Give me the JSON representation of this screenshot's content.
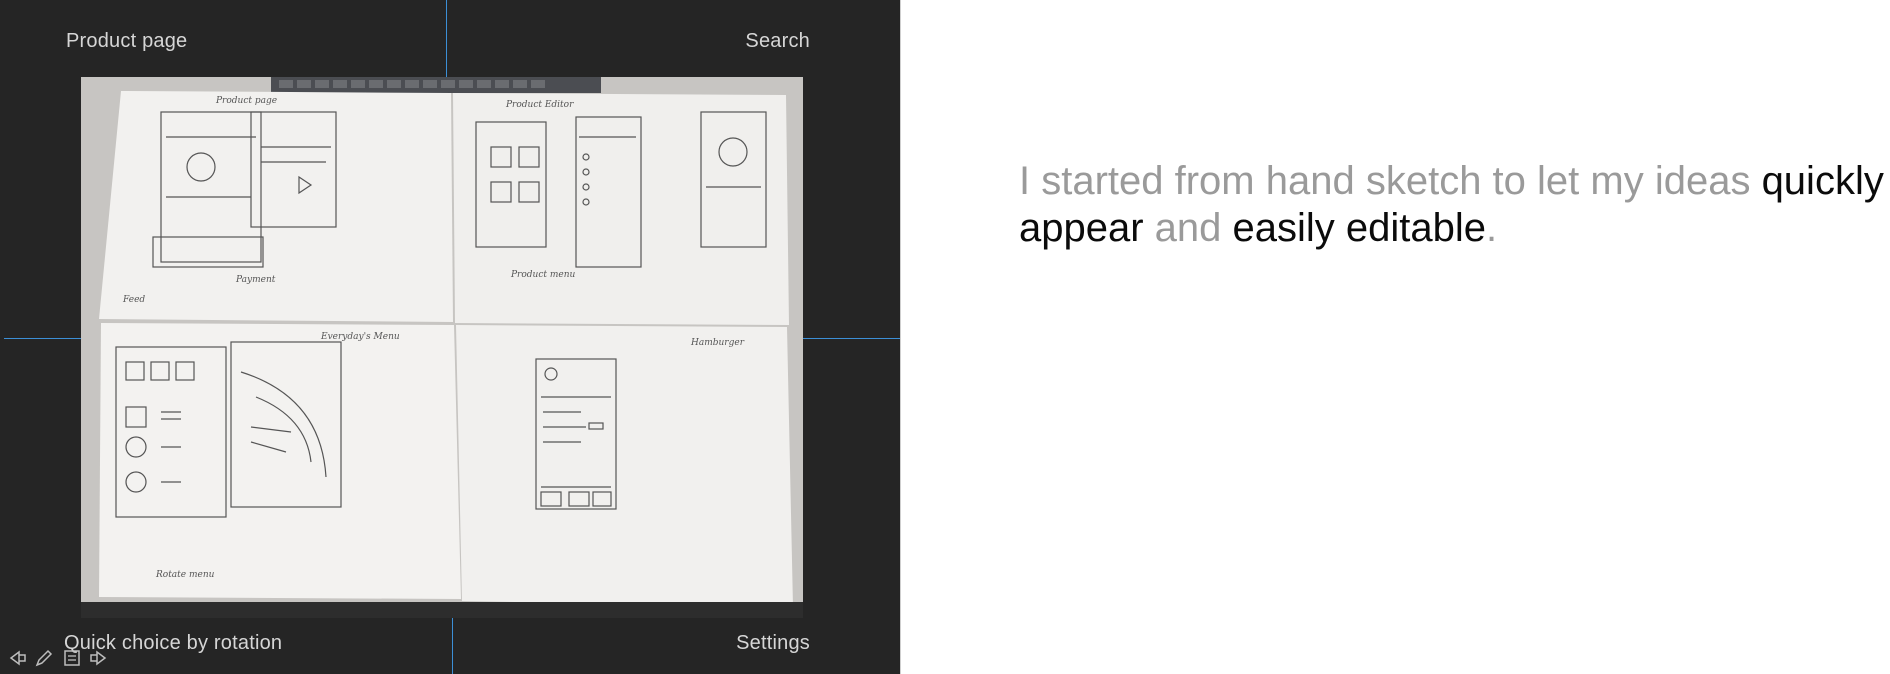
{
  "slide": {
    "label_top_left": "Product page",
    "label_top_right": "Search",
    "label_bottom_left": "Quick choice by rotation",
    "label_bottom_right": "Settings",
    "guide_color": "#3c8fd6",
    "background": "#252525"
  },
  "photo": {
    "description_icon": "hand-sketch-photo",
    "sheet_titles": [
      "Product page",
      "Product Editor",
      "Everyday's Menu",
      "Hamburger"
    ],
    "sheet_notes": [
      "Feed",
      "Rotate menu",
      "Product menu",
      "Payment"
    ]
  },
  "toolbar": {
    "icons": [
      "arrow-left-icon",
      "pencil-icon",
      "notes-icon",
      "arrow-right-icon"
    ]
  },
  "caption": {
    "seg1": "I started from hand sketch to let my ideas ",
    "seg2": "quickly",
    "seg3": "appear",
    "seg4": " and ",
    "seg5": "easily editable",
    "seg6": ".",
    "highlight_color": "#0b0b0b",
    "muted_color": "#9a9a9a"
  }
}
